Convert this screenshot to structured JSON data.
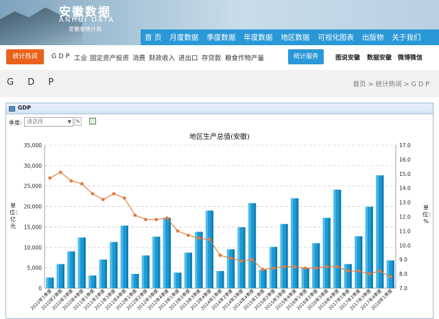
{
  "header": {
    "logo_cn": "安徽数据",
    "logo_en": "ANHUI DATA",
    "logo_sub": "安徽省统计局",
    "nav": [
      "首 页",
      "月度数据",
      "季度数据",
      "年度数据",
      "地区数据",
      "可视化图表",
      "出版物",
      "关于我们"
    ]
  },
  "subbar": {
    "hot_label": "统计热词",
    "keywords": [
      "G D P",
      "工业",
      "固定资产投资",
      "消费",
      "财政收入",
      "进出口",
      "存贷款",
      "粮食作物产量"
    ],
    "service_label": "统计服务",
    "right_links": [
      "图说安徽",
      "数据安徽",
      "微博微信"
    ]
  },
  "page": {
    "title": "G D P",
    "breadcrumb": "首页 > 统计热词 > G D P"
  },
  "panel": {
    "title": "GDP",
    "season_label": "季度:",
    "season_placeholder": "请选择"
  },
  "colors": {
    "bar": "#1a9ad6",
    "line": "#e07b3c",
    "nav": "#2a98d6",
    "hot": "#e8621c"
  },
  "chart_data": {
    "type": "bar",
    "title": "地区生产总值(安徽)",
    "ylabel_left": "单位：亿元",
    "ylabel_right": "单位：%",
    "y_left_range": [
      0,
      35000
    ],
    "y_left_ticks": [
      "0",
      "5,000",
      "10,000",
      "15,000",
      "20,000",
      "25,000",
      "30,000",
      "35,000"
    ],
    "y_right_range": [
      7.0,
      17.0
    ],
    "y_right_ticks": [
      "7.0",
      "8.0",
      "9.0",
      "10.0",
      "11.0",
      "12.0",
      "13.0",
      "14.0",
      "15.0",
      "16.0",
      "17.0"
    ],
    "categories": [
      "2010年1季度",
      "2010年2季度",
      "2010年3季度",
      "2010年4季度",
      "2011年1季度",
      "2011年2季度",
      "2011年3季度",
      "2011年4季度",
      "2012年1季度",
      "2012年2季度",
      "2012年3季度",
      "2012年4季度",
      "2013年1季度",
      "2013年2季度",
      "2013年3季度",
      "2013年4季度",
      "2014年1季度",
      "2014年2季度",
      "2014年3季度",
      "2014年4季度",
      "2015年1季度",
      "2015年2季度",
      "2015年3季度",
      "2015年4季度",
      "2016年1季度",
      "2016年2季度",
      "2016年3季度",
      "2016年4季度",
      "2017年1季度",
      "2017年2季度",
      "2017年3季度",
      "2017年4季度",
      "2018年1季度"
    ],
    "series": [
      {
        "values": [
          2600,
          5900,
          9000,
          12400,
          3100,
          7000,
          11300,
          15300,
          3500,
          8000,
          12600,
          17200,
          3800,
          8700,
          13800,
          19000,
          4200,
          9500,
          14900,
          20800,
          4500,
          10100,
          15700,
          22000,
          4900,
          11000,
          17200,
          24100,
          5900,
          12700,
          19900,
          27600,
          6800
        ]
      },
      {
        "values": [
          14.7,
          15.1,
          14.5,
          14.3,
          13.6,
          13.2,
          13.6,
          13.3,
          12.1,
          11.8,
          11.8,
          11.9,
          11.0,
          10.7,
          10.5,
          10.4,
          9.3,
          9.1,
          8.9,
          9.0,
          8.3,
          8.4,
          8.5,
          8.5,
          8.4,
          8.4,
          8.5,
          8.5,
          8.2,
          8.2,
          8.0,
          8.2,
          7.8
        ]
      }
    ]
  }
}
